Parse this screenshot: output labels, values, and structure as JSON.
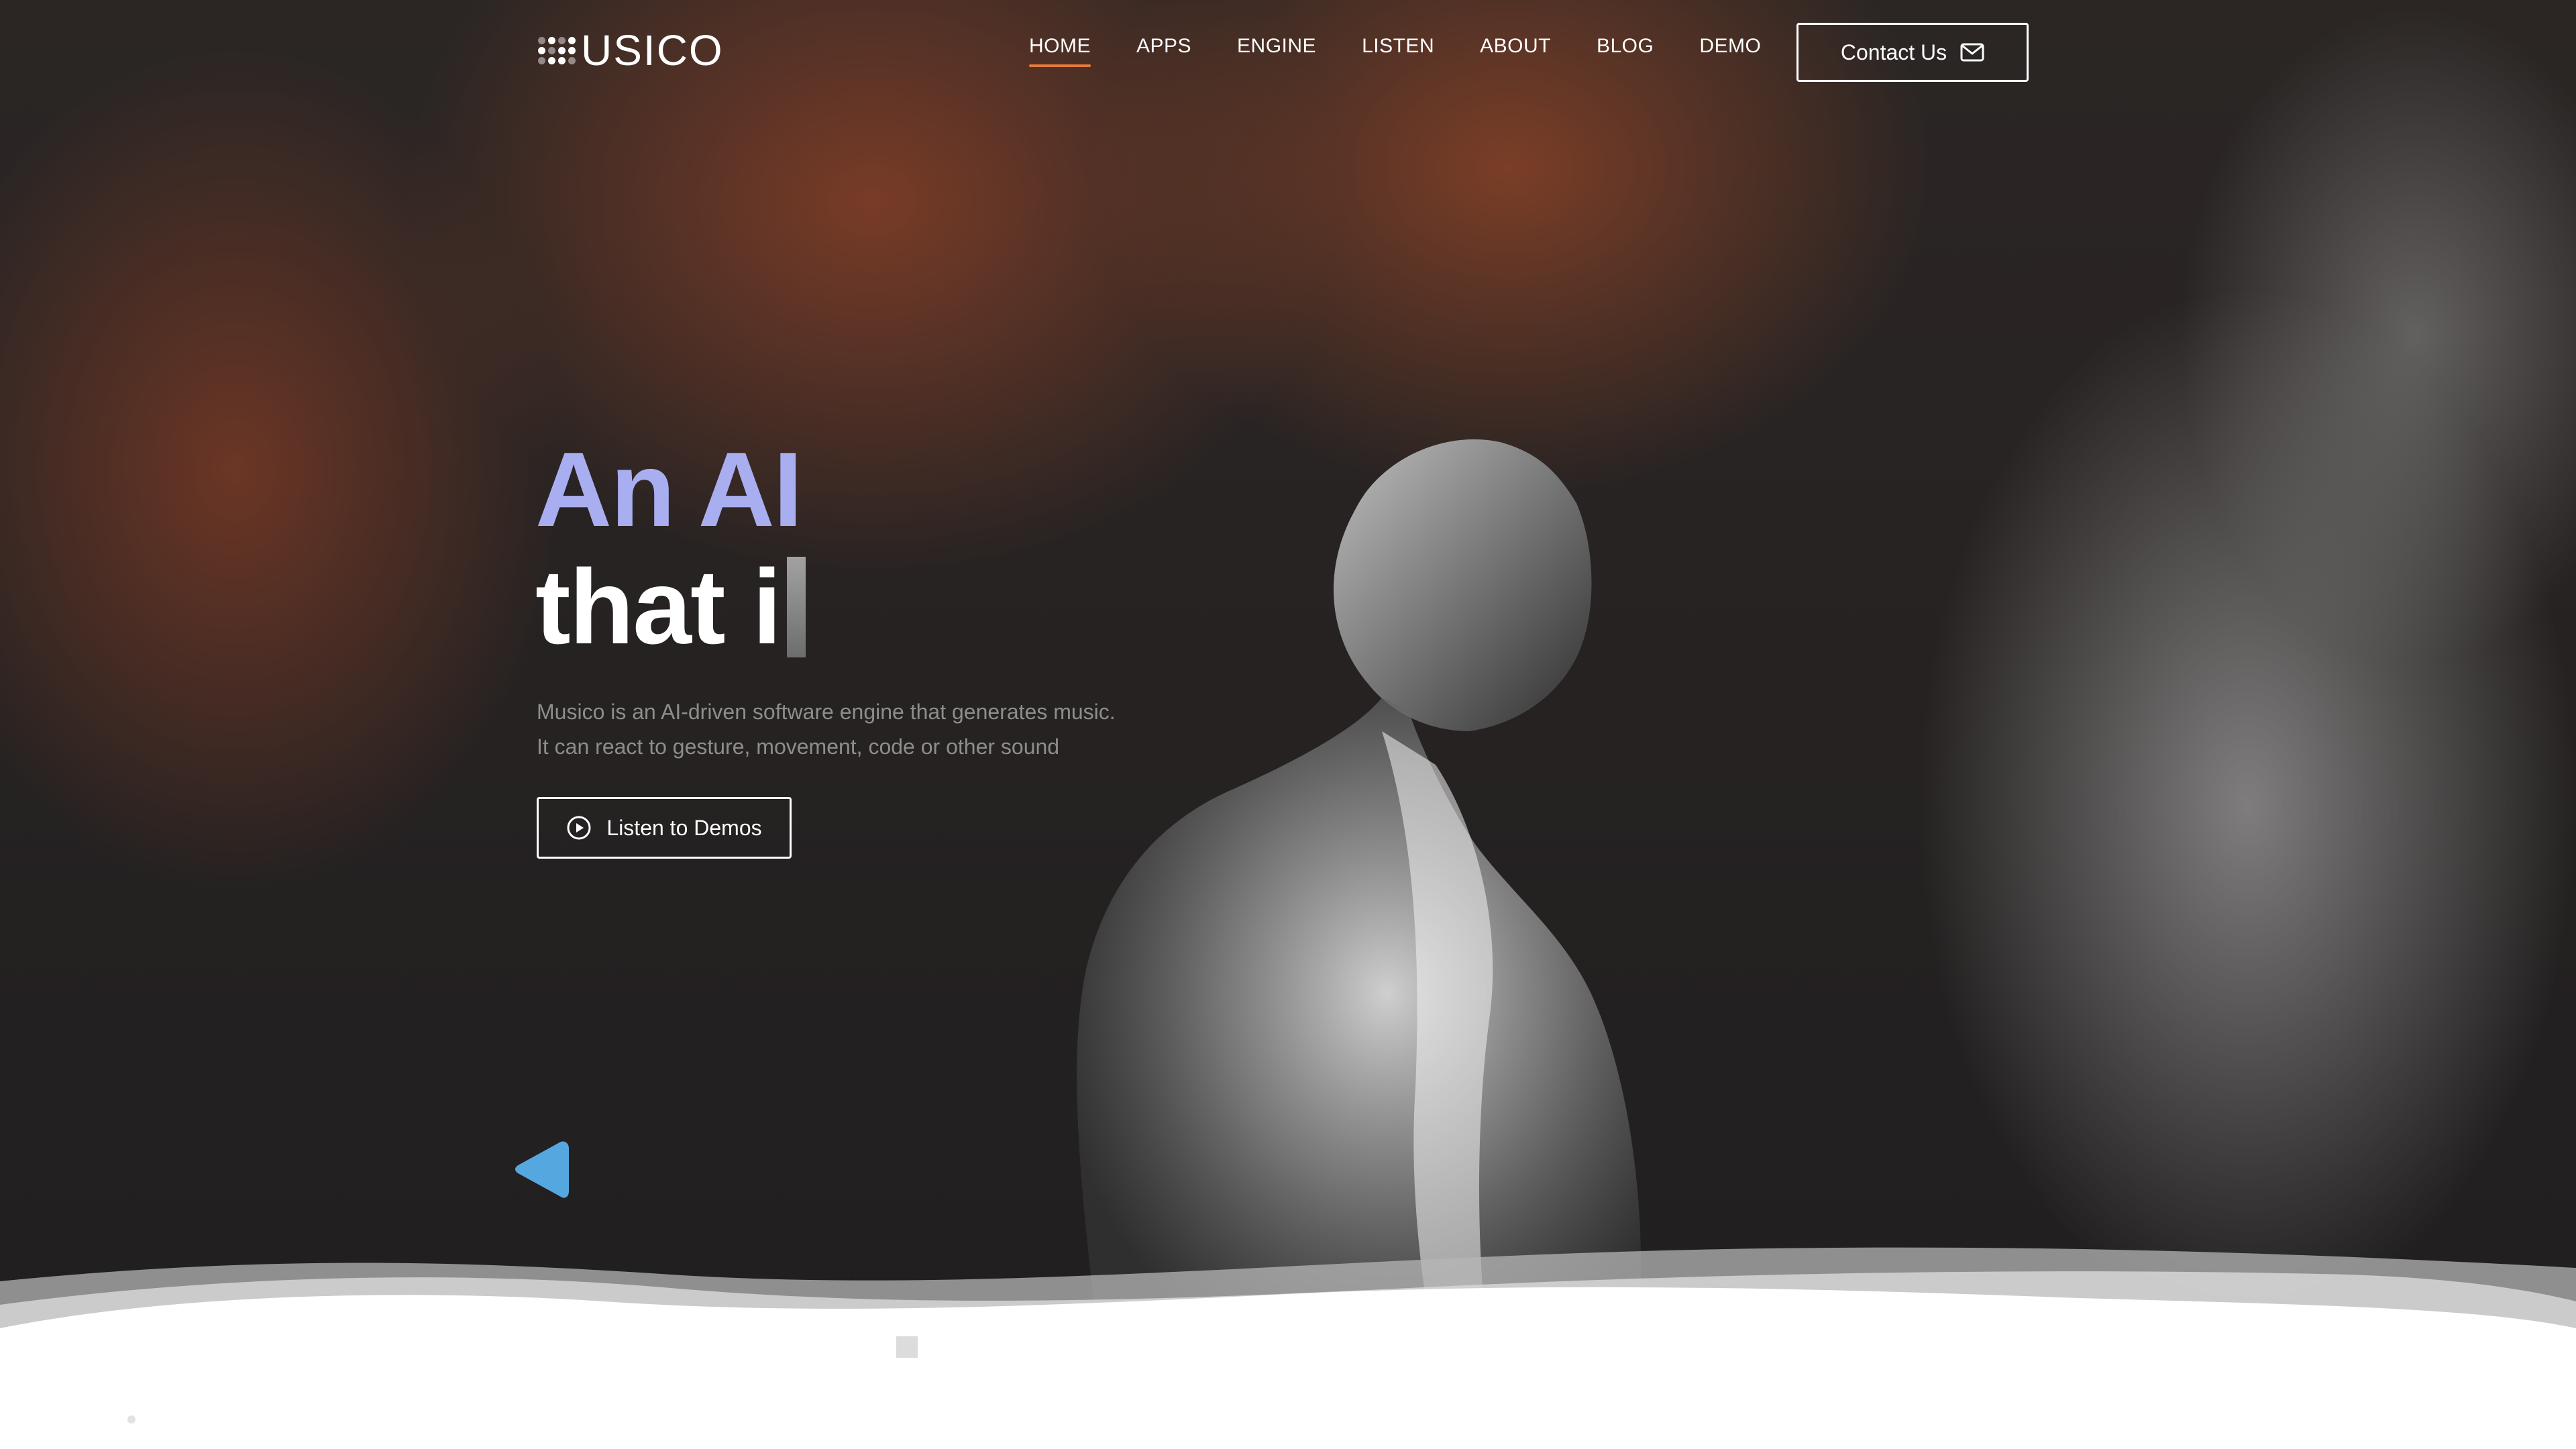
{
  "logo": {
    "text": "USICO",
    "icon": "dot-grid-logo-icon"
  },
  "nav": {
    "items": [
      {
        "label": "HOME",
        "active": true
      },
      {
        "label": "APPS",
        "active": false
      },
      {
        "label": "ENGINE",
        "active": false
      },
      {
        "label": "LISTEN",
        "active": false
      },
      {
        "label": "ABOUT",
        "active": false
      },
      {
        "label": "BLOG",
        "active": false
      },
      {
        "label": "DEMO",
        "active": false
      }
    ],
    "active_underline_color": "#e67a3c"
  },
  "contact": {
    "label": "Contact Us",
    "icon": "envelope-icon"
  },
  "hero": {
    "headline_line1": "An AI",
    "headline_line2": "that i",
    "headline_line1_color": "#a9aef0",
    "description_line1": "Musico is an AI-driven software engine that generates music.",
    "description_line2": "It can react to gesture, movement, code or other sound",
    "cta_label": "Listen to Demos",
    "cta_icon": "play-circle-icon"
  },
  "slider": {
    "prev_icon": "triangle-left-icon",
    "prev_color": "#55a8df"
  }
}
